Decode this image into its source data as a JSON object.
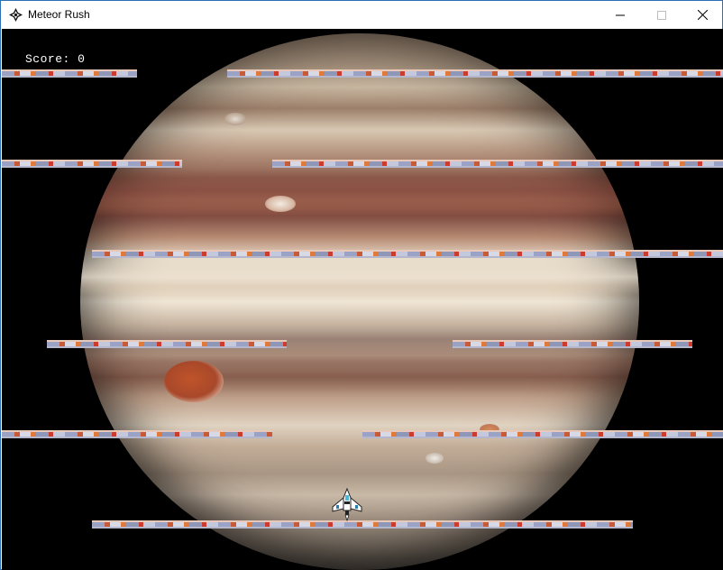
{
  "window": {
    "title": "Meteor Rush",
    "icons": {
      "app": "meteor-app-icon",
      "minimize": "minimize-icon",
      "maximize": "maximize-icon",
      "close": "close-icon"
    }
  },
  "game": {
    "score_text": "Score: 0",
    "score": 0,
    "background": "jupiter-planet",
    "colors": {
      "space": "#000000",
      "text": "#ffffff"
    },
    "player": "spaceship"
  }
}
